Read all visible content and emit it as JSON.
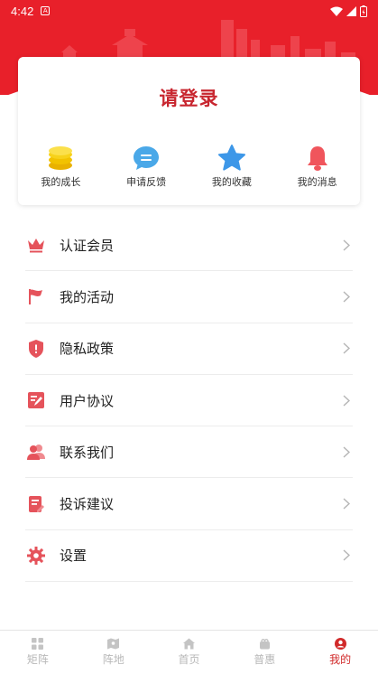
{
  "status_bar": {
    "time": "4:42"
  },
  "header": {
    "login_text": "请登录"
  },
  "quick_actions": [
    {
      "label": "我的成长",
      "icon": "coins-icon"
    },
    {
      "label": "申请反馈",
      "icon": "chat-icon"
    },
    {
      "label": "我的收藏",
      "icon": "star-icon"
    },
    {
      "label": "我的消息",
      "icon": "bell-icon"
    }
  ],
  "menu": [
    {
      "label": "认证会员",
      "icon": "crown-icon"
    },
    {
      "label": "我的活动",
      "icon": "flag-icon"
    },
    {
      "label": "隐私政策",
      "icon": "shield-icon"
    },
    {
      "label": "用户协议",
      "icon": "document-edit-icon"
    },
    {
      "label": "联系我们",
      "icon": "contacts-icon"
    },
    {
      "label": "投诉建议",
      "icon": "complaint-icon"
    },
    {
      "label": "设置",
      "icon": "gear-icon"
    }
  ],
  "tabbar": [
    {
      "label": "矩阵",
      "icon": "grid-icon",
      "active": false
    },
    {
      "label": "阵地",
      "icon": "map-icon",
      "active": false
    },
    {
      "label": "首页",
      "icon": "home-icon",
      "active": false
    },
    {
      "label": "普惠",
      "icon": "gift-icon",
      "active": false
    },
    {
      "label": "我的",
      "icon": "user-icon",
      "active": true
    }
  ],
  "colors": {
    "brand_red": "#e8202a",
    "title_red": "#c8262f",
    "icon_red": "#e5535b",
    "active_tab": "#d12a2a"
  }
}
